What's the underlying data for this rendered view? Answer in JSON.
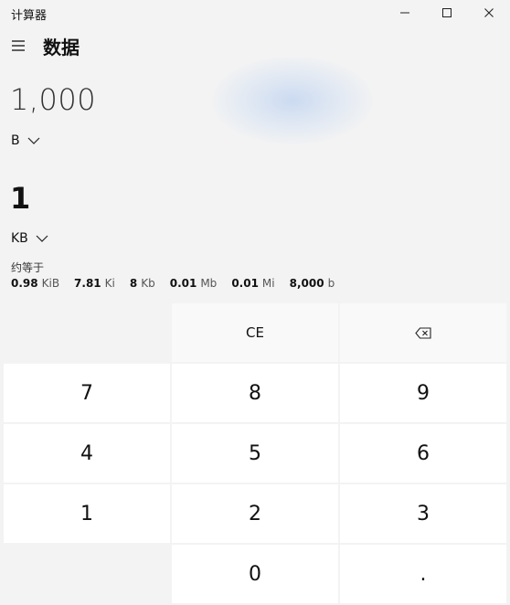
{
  "window": {
    "title": "计算器"
  },
  "header": {
    "mode_title": "数据"
  },
  "converter": {
    "input_value": "1,000",
    "from_unit": "B",
    "output_value": "1",
    "to_unit": "KB",
    "approx_label": "约等于",
    "approximations": [
      {
        "value": "0.98",
        "unit": "KiB"
      },
      {
        "value": "7.81",
        "unit": "Ki"
      },
      {
        "value": "8",
        "unit": "Kb"
      },
      {
        "value": "0.01",
        "unit": "Mb"
      },
      {
        "value": "0.01",
        "unit": "Mi"
      },
      {
        "value": "8,000",
        "unit": "b"
      }
    ]
  },
  "keypad": {
    "ce": "CE",
    "k7": "7",
    "k8": "8",
    "k9": "9",
    "k4": "4",
    "k5": "5",
    "k6": "6",
    "k1": "1",
    "k2": "2",
    "k3": "3",
    "k0": "0",
    "dot": "."
  },
  "icons": {
    "minimize": "minimize-icon",
    "maximize": "maximize-icon",
    "close": "close-icon",
    "menu": "hamburger-icon",
    "chevron": "chevron-down-icon",
    "backspace": "backspace-icon"
  }
}
